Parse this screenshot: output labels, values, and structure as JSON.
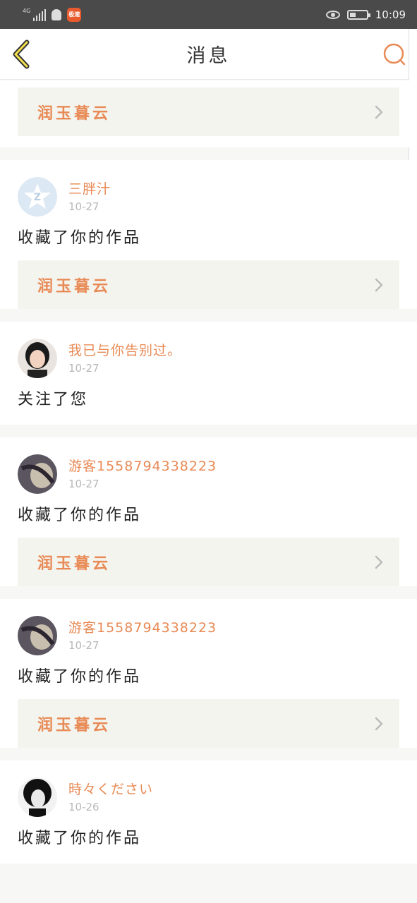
{
  "status_bar": {
    "network": "4G",
    "app_badge": "极速",
    "time": "10:09"
  },
  "header": {
    "title": "消息"
  },
  "first_card": {
    "work_title": "润玉暮云"
  },
  "messages": [
    {
      "username": "三胖汁",
      "time": "10-27",
      "action": "收藏了你的作品",
      "work_title": "润玉暮云"
    },
    {
      "username": "我已与你告别过。",
      "time": "10-27",
      "action": "关注了您"
    },
    {
      "username": "游客1558794338223",
      "time": "10-27",
      "action": "收藏了你的作品",
      "work_title": "润玉暮云"
    },
    {
      "username": "游客1558794338223",
      "time": "10-27",
      "action": "收藏了你的作品",
      "work_title": "润玉暮云"
    },
    {
      "username": "時々ください",
      "time": "10-26",
      "action": "收藏了你的作品"
    }
  ],
  "colors": {
    "accent": "#e88a55",
    "link_bg": "#f4f4ef",
    "status_bar": "#4a4a4a"
  }
}
